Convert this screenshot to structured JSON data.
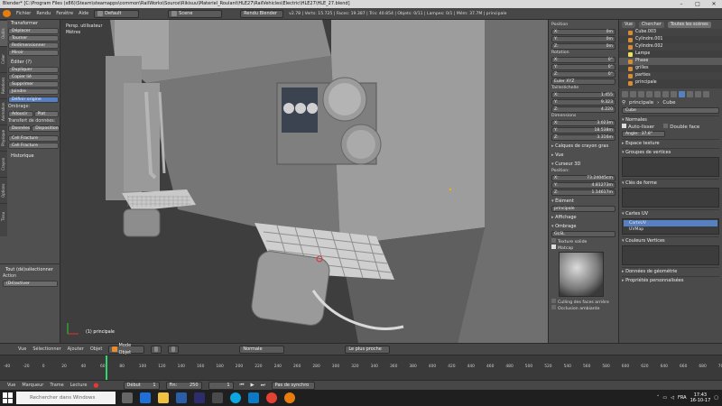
{
  "window": {
    "title": "Blender* [C:\\Program Files (x86)\\Steam\\steamapps\\common\\RailWorks\\Source\\Rikisuu\\Materiel_Roulant\\HLE27\\RailVehicles\\Electric\\HLE27\\HLE_27.blend]"
  },
  "topbar": {
    "menus": [
      "Fichier",
      "Rendu",
      "Fenêtre",
      "Aide"
    ],
    "layout": "Default",
    "scene": "Scene",
    "engine": "Rendu Blender",
    "stats": "v2.78 | Verts: 15.725 | Faces: 19.387 | Tris: 40.854 | Objets: 0/11 | Lampes: 0/1 | Mém: 37.7M | principale"
  },
  "toolshelf": {
    "tabs": [
      "Outils",
      "Créer",
      "Relations",
      "Animation",
      "Physique",
      "Crayon",
      "Options",
      "Tissu"
    ],
    "transform": {
      "title": "Transformer",
      "buttons": [
        "Déplacer",
        "Tourner",
        "Redimensionner",
        "Miroir"
      ]
    },
    "edit": {
      "title": "Éditer (?)",
      "buttons": [
        "Dupliquer",
        "Copier lié",
        "Supprimer",
        "Joindre"
      ],
      "origin": "Définir origine"
    },
    "shading": {
      "title": "Ombrage:",
      "buttons": [
        "Adoucir",
        "Plat"
      ]
    },
    "data": {
      "title": "Transfert de données:",
      "buttons": [
        "Données",
        "Disposition"
      ]
    },
    "extra": [
      "Cell Fracture",
      "Cell Fracture"
    ],
    "history": "Historique",
    "last_op": "Tout (dé)sélectionner",
    "action_label": "Action",
    "action_value": "(Dé)activer"
  },
  "viewport": {
    "overlay_title": "Persp. utilisateur",
    "overlay_units": "Mètres",
    "object_label": "(1) principale"
  },
  "npanel": {
    "location_title": "Position",
    "location": [
      {
        "axis": "X:",
        "val": "0m"
      },
      {
        "axis": "Y:",
        "val": "0m"
      },
      {
        "axis": "Z:",
        "val": "0m"
      }
    ],
    "rotation_title": "Rotation",
    "rotation": [
      {
        "axis": "X:",
        "val": "0°"
      },
      {
        "axis": "Y:",
        "val": "0°"
      },
      {
        "axis": "Z:",
        "val": "0°"
      }
    ],
    "rot_mode": "Euler XYZ",
    "scale_title": "Taille/échelle",
    "scale": [
      {
        "axis": "X:",
        "val": "1.455"
      },
      {
        "axis": "Y:",
        "val": "9.323"
      },
      {
        "axis": "Z:",
        "val": "4.220"
      }
    ],
    "dim_title": "Dimensions",
    "dims": [
      {
        "axis": "X:",
        "val": "3.023m"
      },
      {
        "axis": "Y:",
        "val": "18.538m"
      },
      {
        "axis": "Z:",
        "val": "3.316m"
      }
    ],
    "grease": "Calques de crayon gras",
    "view": "Vue",
    "cursor": "Curseur 3D",
    "cursor_pos_title": "Position:",
    "cursor_pos": [
      {
        "axis": "X:",
        "val": "73.24045cm"
      },
      {
        "axis": "Y:",
        "val": "4.81273m"
      },
      {
        "axis": "Z:",
        "val": "1.14617m"
      }
    ],
    "element": "Élément",
    "element_name": "principale",
    "display": "Affichage",
    "shading": "Ombrage",
    "shading_mode": "GLSL",
    "solid_tex": "Texture solide",
    "matcap": "Matcap",
    "backface": "Culling des faces arrière",
    "ao": "Occlusion ambiante"
  },
  "outliner": {
    "tabs": [
      "Vue",
      "Chercher",
      "Toutes les scènes"
    ],
    "items": [
      "Cube.003",
      "Cylindre.001",
      "Cylindre.002",
      "Lampe",
      "Phase",
      "grilles",
      "parties",
      "principale"
    ]
  },
  "props": {
    "breadcrumb": "principale",
    "breadcrumb2": "Cube",
    "mesh": "Cube",
    "normals": "Normales",
    "autosmooth": "Auto-lisser",
    "double": "Double face",
    "angle_label": "Angle:",
    "angle_value": "37.8°",
    "texspace": "Espace texture",
    "vgroups": "Groupes de vertices",
    "shapes": "Clés de forme",
    "uvmaps": "Cartes UV",
    "uv_items": [
      "CarteUV",
      "UVMap"
    ],
    "vcolors": "Couleurs Vertices",
    "geometry": "Données de géométrie",
    "custom": "Propriétés personnalisées"
  },
  "vheader": {
    "menus": [
      "Vue",
      "Sélectionner",
      "Ajouter",
      "Objet"
    ],
    "mode": "Mode Objet",
    "pivot": "Normale",
    "snap": "Le plus proche"
  },
  "timeline": {
    "ticks": [
      "-40",
      "-20",
      "0",
      "20",
      "40",
      "60",
      "80",
      "100",
      "120",
      "140",
      "160",
      "180",
      "200",
      "220",
      "240",
      "260",
      "280",
      "300",
      "320",
      "340",
      "360",
      "380",
      "400",
      "420",
      "440",
      "460",
      "480",
      "500",
      "520",
      "540",
      "560",
      "580",
      "600",
      "620",
      "640",
      "660",
      "680",
      "700"
    ],
    "current_frame": 1
  },
  "tlheader": {
    "menus": [
      "Vue",
      "Marqueur",
      "Trame",
      "Lecture"
    ],
    "start_label": "Début",
    "start": "1",
    "end_label": "Fin:",
    "end": "250",
    "frame": "1",
    "sync": "Pas de synchro"
  },
  "taskbar": {
    "search_placeholder": "Rechercher dans Windows",
    "lang": "FRA",
    "time": "17:43",
    "date": "16-10-17"
  },
  "colors": {
    "accent": "#5680c2",
    "frame_cursor": "#2fd86a",
    "object_orange": "#d78c35"
  }
}
